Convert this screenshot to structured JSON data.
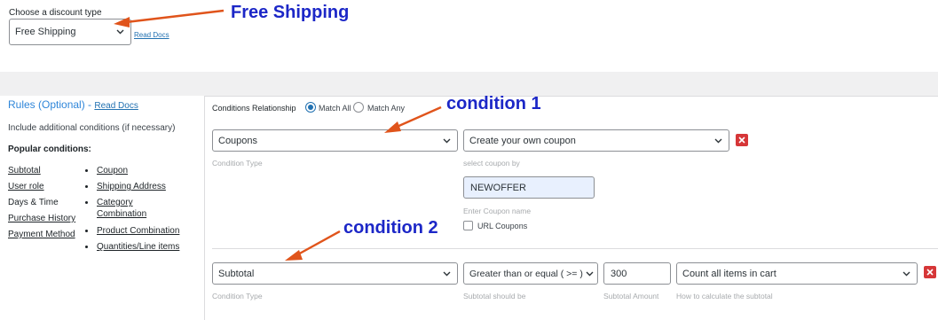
{
  "discount": {
    "label": "Choose a discount type",
    "selected": "Free Shipping",
    "read_docs": "Read Docs"
  },
  "annotations": {
    "free_shipping": "Free Shipping",
    "condition1": "condition 1",
    "condition2": "condition 2",
    "arrow_color": "#e0541b",
    "text_color": "#1c27c7"
  },
  "rules": {
    "title": "Rules (Optional) - ",
    "read_docs": "Read Docs",
    "description": "Include additional conditions (if necessary)",
    "popular_heading": "Popular conditions:",
    "left_items": [
      "Subtotal",
      "User role",
      "Days & Time",
      "Purchase History",
      "Payment Method"
    ],
    "right_items": [
      "Coupon",
      "Shipping Address",
      "Category Combination",
      "Product Combination",
      "Quantities/Line items"
    ]
  },
  "conditions": {
    "relationship_label": "Conditions Relationship",
    "match_all": "Match All",
    "match_any": "Match Any",
    "selected": "Match All",
    "condition1": {
      "type": "Coupons",
      "type_hint": "Condition Type",
      "coupon_select": "Create your own coupon",
      "coupon_hint": "select coupon by",
      "coupon_name": "NEWOFFER",
      "coupon_name_hint": "Enter Coupon name",
      "url_coupons": "URL Coupons"
    },
    "condition2": {
      "type": "Subtotal",
      "type_hint": "Condition Type",
      "operator": "Greater than or equal ( >= )",
      "operator_hint": "Subtotal should be",
      "amount": "300",
      "amount_hint": "Subtotal Amount",
      "calc": "Count all items in cart",
      "calc_hint": "How to calculate the subtotal"
    }
  }
}
